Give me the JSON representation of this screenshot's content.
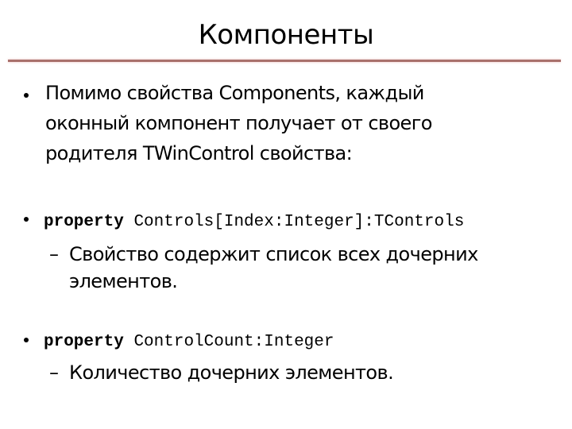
{
  "slide": {
    "title": "Компоненты",
    "bullets": [
      {
        "lines": [
          "Помимо свойства Components, каждый",
          "оконный компонент получает от своего",
          "родителя TWinControl свойства:"
        ]
      },
      {
        "keyword": "property",
        "code": "Controls[Index:Integer]:TControls",
        "sub": {
          "dash": "–",
          "lines": [
            "Свойство содержит список всех дочерних",
            "элементов."
          ]
        }
      },
      {
        "keyword": "property",
        "code": "ControlCount:Integer",
        "sub": {
          "dash": "–",
          "lines": [
            "Количество дочерних элементов."
          ]
        }
      }
    ],
    "accent_color": "#a9716c"
  }
}
